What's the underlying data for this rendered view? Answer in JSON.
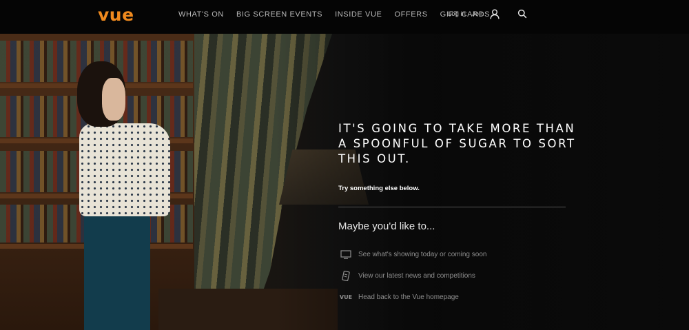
{
  "brand": {
    "logo": "vue",
    "accent_color": "#f08a1e"
  },
  "nav": {
    "items": [
      "WHAT'S ON",
      "BIG SCREEN EVENTS",
      "INSIDE VUE",
      "OFFERS",
      "GIFT CARDS"
    ]
  },
  "account": {
    "login": "Log in",
    "join": "Join",
    "user_icon": "user-icon",
    "search_icon": "search-icon"
  },
  "hero": {
    "headline": "IT'S GOING TO TAKE MORE THAN A SPOONFUL OF SUGAR TO SORT THIS OUT.",
    "subline": "Try something else below.",
    "maybe": "Maybe you'd like to...",
    "options": [
      {
        "icon": "screen-icon",
        "label": "See what's showing today or coming soon"
      },
      {
        "icon": "ticket-icon",
        "label": "View our latest news and competitions"
      },
      {
        "icon": "vue-logo-icon",
        "icon_text": "VUE",
        "label": "Head back to the Vue homepage"
      }
    ]
  }
}
